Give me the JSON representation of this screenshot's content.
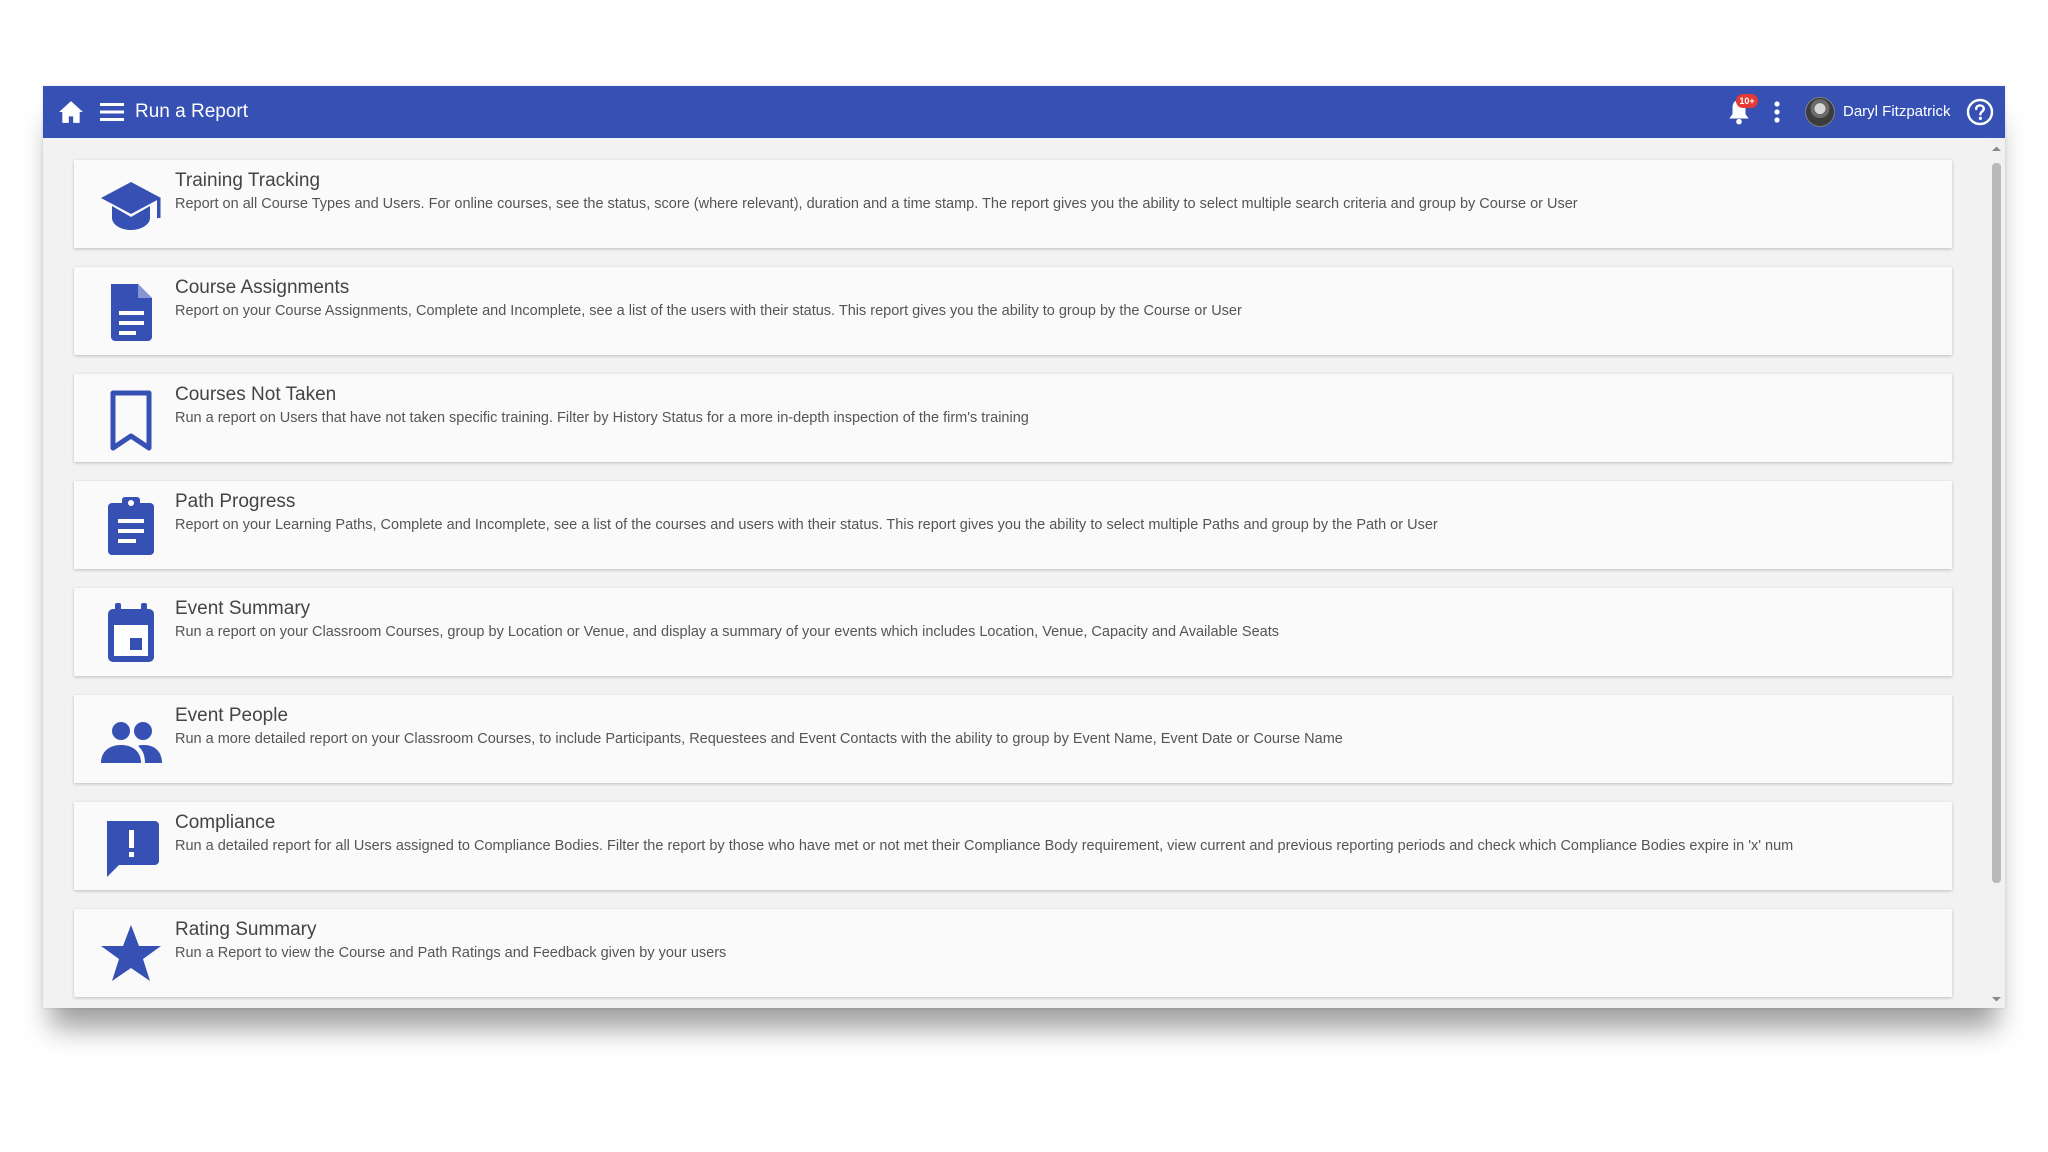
{
  "header": {
    "title": "Run a Report",
    "notification_badge": "10+",
    "user_name": "Daryl Fitzpatrick",
    "bar_color": "#3650b4"
  },
  "icons": {
    "home": "home-icon",
    "menu": "hamburger-menu-icon",
    "notifications": "bell-icon",
    "more": "more-vertical-icon",
    "help": "help-circle-icon"
  },
  "accent_color": "#3650b4",
  "reports": [
    {
      "title": "Training Tracking",
      "description": "Report on all Course Types and Users. For online courses, see the status, score (where relevant), duration and a time stamp. The report gives you the ability to select multiple search criteria and group by Course or User",
      "icon": "graduation-cap-icon"
    },
    {
      "title": "Course Assignments",
      "description": "Report on your Course Assignments, Complete and Incomplete, see a list of the users with their status. This report gives you the ability to group by the Course or User",
      "icon": "document-icon"
    },
    {
      "title": "Courses Not Taken",
      "description": "Run a report on Users that have not taken specific training. Filter by History Status for a more in-depth inspection of the firm's training",
      "icon": "bookmark-icon"
    },
    {
      "title": "Path Progress",
      "description": "Report on your Learning Paths, Complete and Incomplete, see a list of the courses and users with their status. This report gives you the ability to select multiple Paths and group by the Path or User",
      "icon": "clipboard-icon"
    },
    {
      "title": "Event Summary",
      "description": "Run a report on your Classroom Courses, group by Location or Venue, and display a summary of your events which includes Location, Venue, Capacity and Available Seats",
      "icon": "calendar-icon"
    },
    {
      "title": "Event People",
      "description": "Run a more detailed report on your Classroom Courses, to include Participants, Requestees and Event Contacts with the ability to group by Event Name, Event Date or Course Name",
      "icon": "people-icon"
    },
    {
      "title": "Compliance",
      "description": "Run a detailed report for all Users assigned to Compliance Bodies. Filter the report by those who have met or not met their Compliance Body requirement, view current and previous reporting periods and check which Compliance Bodies expire in 'x' num",
      "icon": "alert-message-icon"
    },
    {
      "title": "Rating Summary",
      "description": "Run a Report to view the Course and Path Ratings and Feedback given by your users",
      "icon": "star-icon"
    }
  ]
}
